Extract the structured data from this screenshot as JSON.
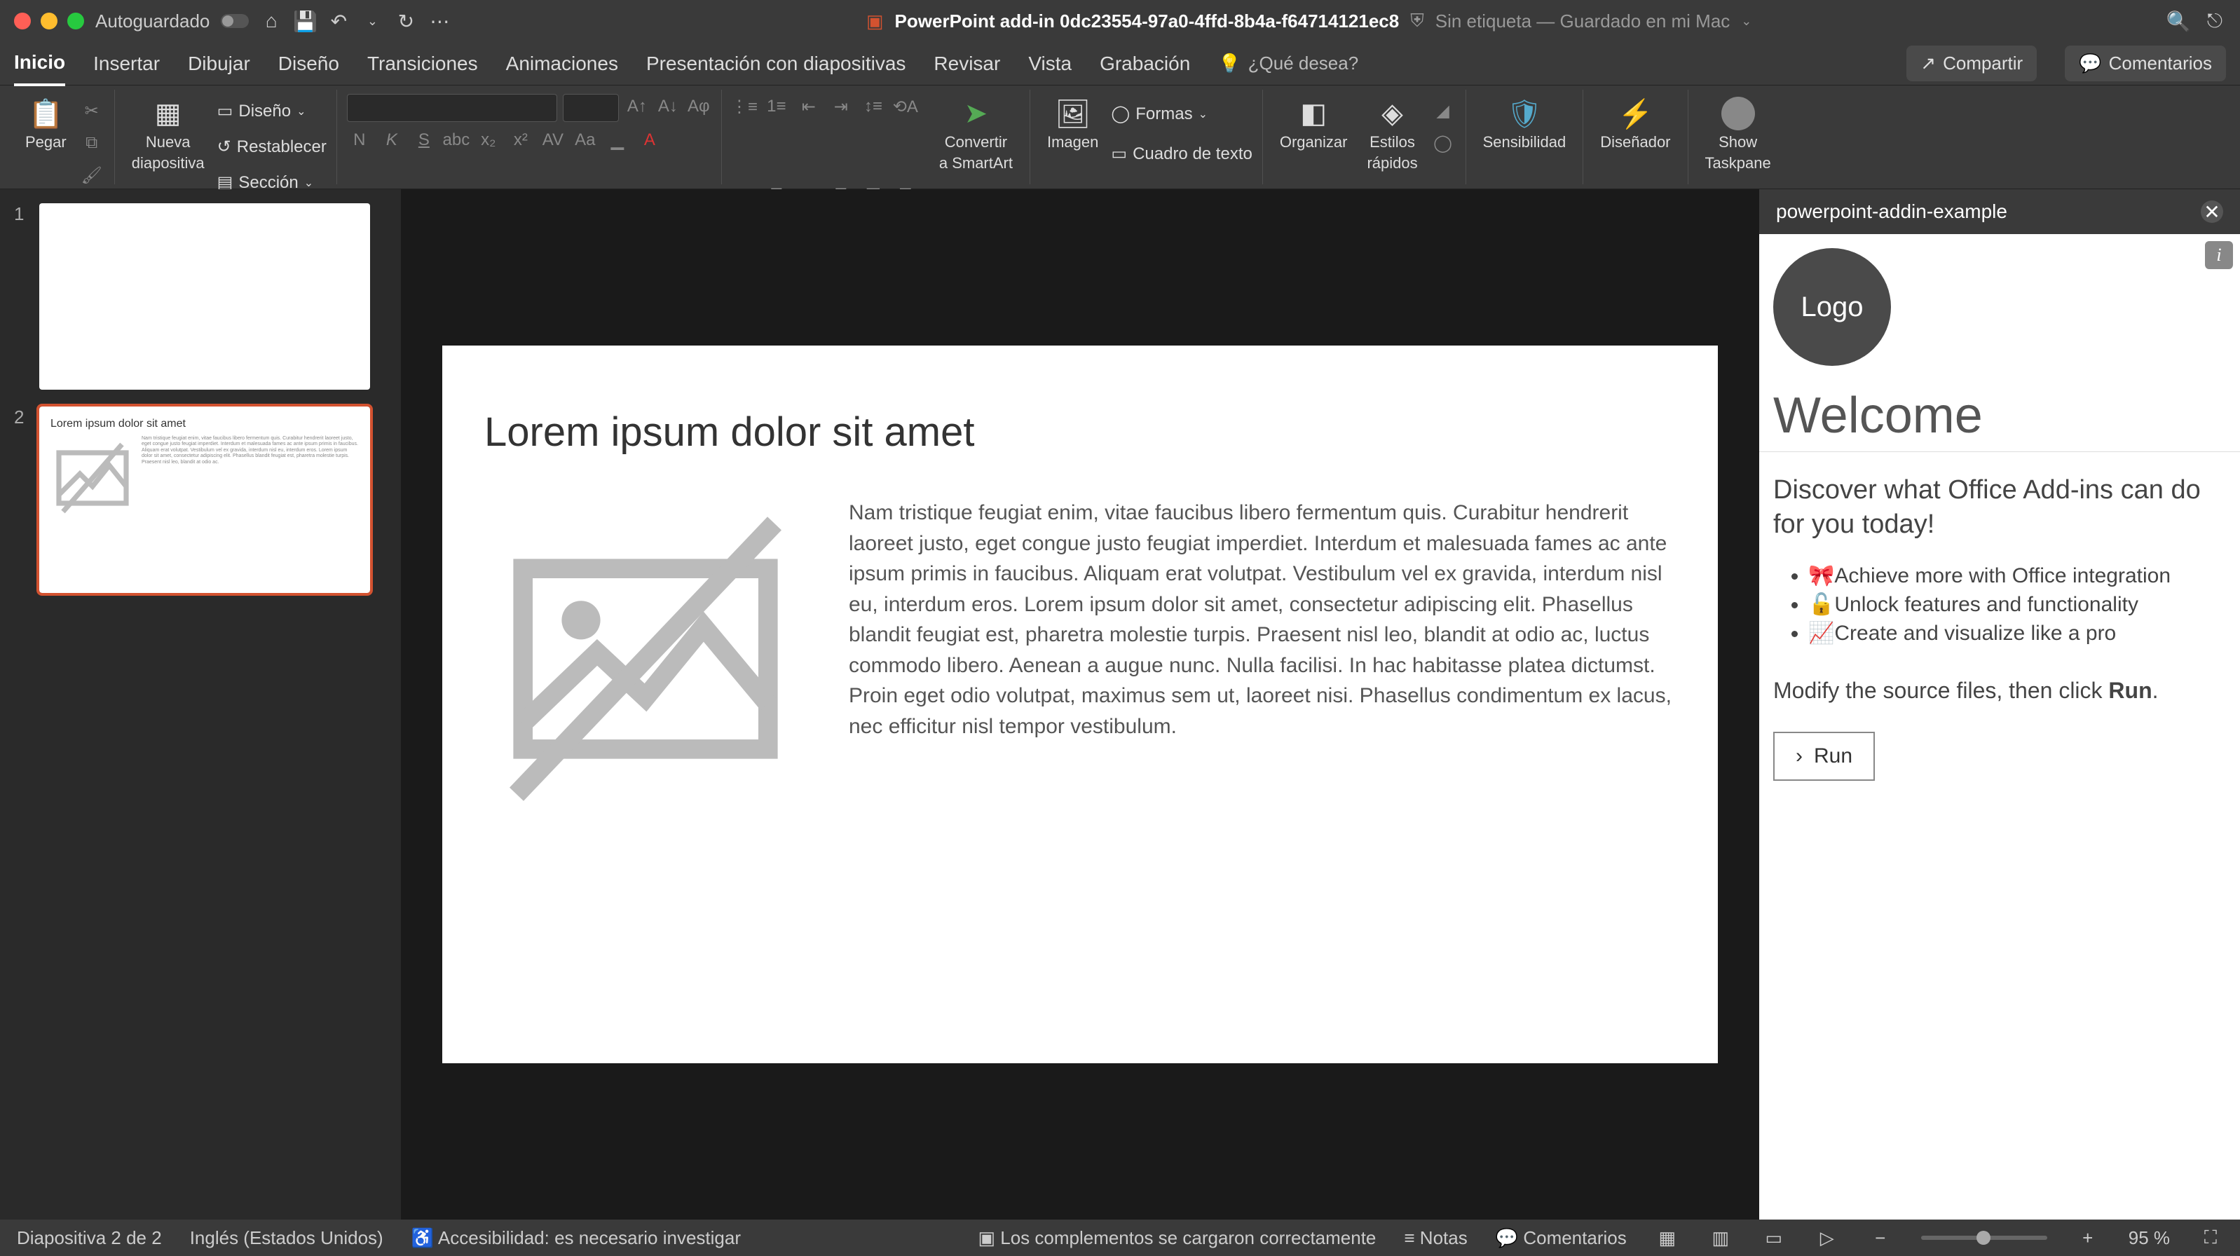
{
  "titlebar": {
    "autosave_label": "Autoguardado",
    "doc_icon": "ppt-icon",
    "doc_title": "PowerPoint add-in 0dc23554-97a0-4ffd-8b4a-f64714121ec8",
    "doc_status": "Sin etiqueta — Guardado en mi Mac"
  },
  "tabs": {
    "items": [
      "Inicio",
      "Insertar",
      "Dibujar",
      "Diseño",
      "Transiciones",
      "Animaciones",
      "Presentación con diapositivas",
      "Revisar",
      "Vista",
      "Grabación"
    ],
    "active": 0,
    "tellme": "¿Qué desea?",
    "share": "Compartir",
    "comments": "Comentarios"
  },
  "ribbon": {
    "paste": "Pegar",
    "new_slide_l1": "Nueva",
    "new_slide_l2": "diapositiva",
    "layout": "Diseño",
    "reset": "Restablecer",
    "section": "Sección",
    "bold": "N",
    "italic": "K",
    "underline": "S",
    "convert_l1": "Convertir",
    "convert_l2": "a SmartArt",
    "image": "Imagen",
    "shapes": "Formas",
    "textbox": "Cuadro de texto",
    "arrange": "Organizar",
    "quick_l1": "Estilos",
    "quick_l2": "rápidos",
    "sensitivity": "Sensibilidad",
    "designer": "Diseñador",
    "show_l1": "Show",
    "show_l2": "Taskpane"
  },
  "thumbs": {
    "items": [
      {
        "num": "1",
        "selected": false,
        "title": ""
      },
      {
        "num": "2",
        "selected": true,
        "title": "Lorem ipsum dolor sit amet"
      }
    ]
  },
  "slide": {
    "title": "Lorem ipsum dolor sit amet",
    "body": "Nam tristique feugiat enim, vitae faucibus libero fermentum quis. Curabitur hendrerit laoreet justo, eget congue justo feugiat imperdiet. Interdum et malesuada fames ac ante ipsum primis in faucibus. Aliquam erat volutpat. Vestibulum vel ex gravida, interdum nisl eu, interdum eros. Lorem ipsum dolor sit amet, consectetur adipiscing elit. Phasellus blandit feugiat est, pharetra molestie turpis. Praesent nisl leo, blandit at odio ac, luctus commodo libero. Aenean a augue nunc. Nulla facilisi. In hac habitasse platea dictumst. Proin eget odio volutpat, maximus sem ut, laoreet nisi. Phasellus condimentum ex lacus, nec efficitur nisl tempor vestibulum."
  },
  "taskpane": {
    "title": "powerpoint-addin-example",
    "logo": "Logo",
    "welcome": "Welcome",
    "subtitle": "Discover what Office Add-ins can do for you today!",
    "features": [
      "Achieve more with Office integration",
      "Unlock features and functionality",
      "Create and visualize like a pro"
    ],
    "run_text_pre": "Modify the source files, then click ",
    "run_text_bold": "Run",
    "run_button": "Run"
  },
  "statusbar": {
    "slide_pos": "Diapositiva 2 de 2",
    "language": "Inglés (Estados Unidos)",
    "accessibility": "Accesibilidad: es necesario investigar",
    "addins": "Los complementos se cargaron correctamente",
    "notes": "Notas",
    "comments": "Comentarios",
    "zoom": "95 %"
  }
}
